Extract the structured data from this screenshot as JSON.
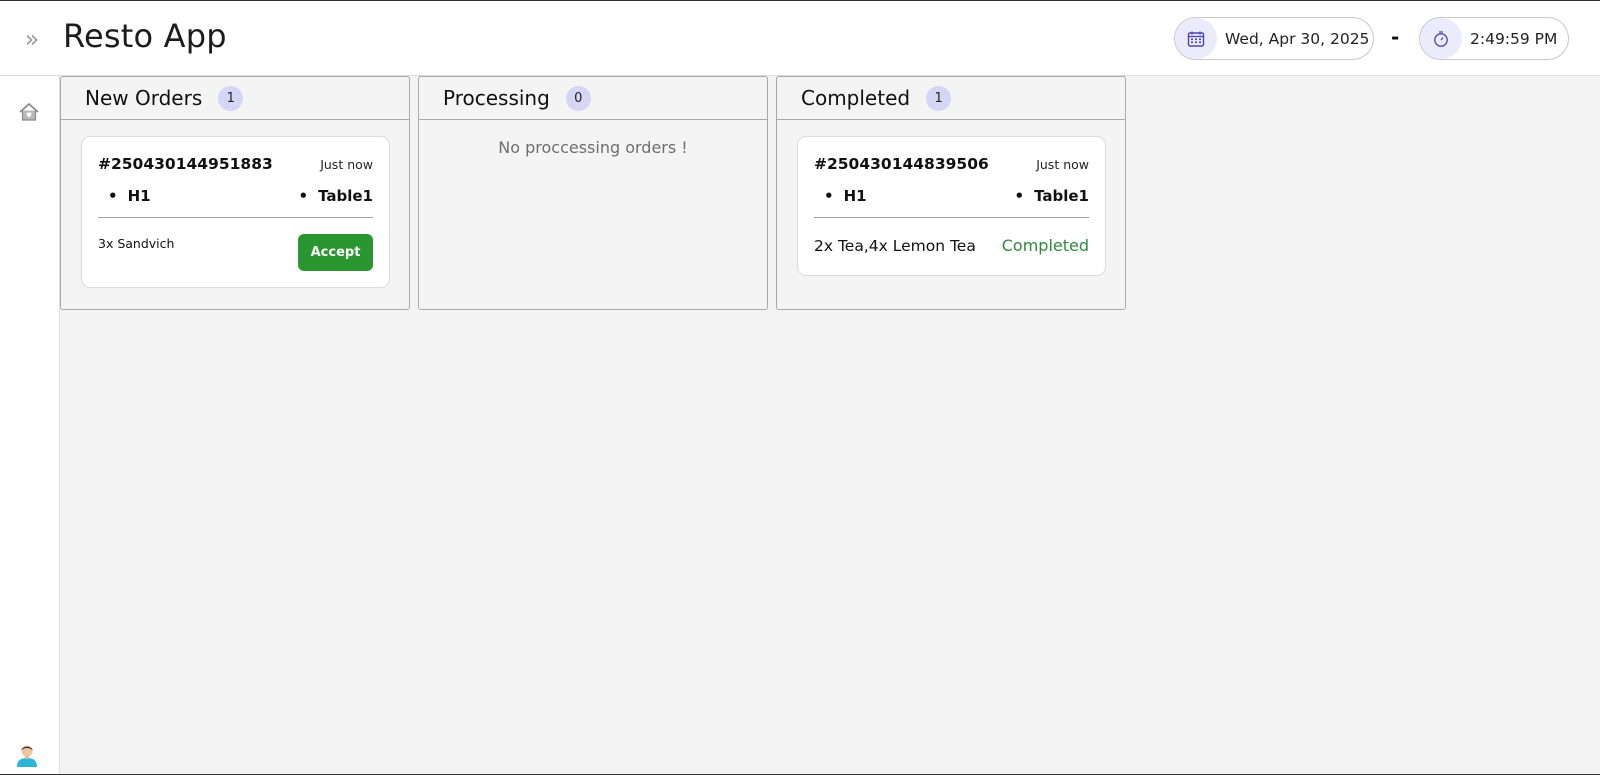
{
  "header": {
    "title": "Resto App",
    "toggle_icon": "double-chevron-right-icon",
    "date": "Wed, Apr 30, 2025",
    "separator": "-",
    "time": "2:49:59 PM",
    "accent_color": "#ecebfc"
  },
  "sidebar": {
    "items": [
      {
        "icon": "home-icon"
      }
    ],
    "user_icon": "user-avatar-icon"
  },
  "columns": [
    {
      "title": "New Orders",
      "count": "1",
      "orders": [
        {
          "id": "#250430144951883",
          "time": "Just now",
          "location": "H1",
          "table": "Table1",
          "items": "3x Sandvich",
          "action": "Accept"
        }
      ]
    },
    {
      "title": "Processing",
      "count": "0",
      "empty_message": "No proccessing orders !"
    },
    {
      "title": "Completed",
      "count": "1",
      "orders": [
        {
          "id": "#250430144839506",
          "time": "Just now",
          "location": "H1",
          "table": "Table1",
          "items": "2x Tea,4x Lemon Tea",
          "status": "Completed"
        }
      ]
    }
  ],
  "colors": {
    "badge": "#d5d6f5",
    "accept_button": "#2a9630",
    "completed_text": "#2f8a3c",
    "background": "#f3f3f3"
  }
}
